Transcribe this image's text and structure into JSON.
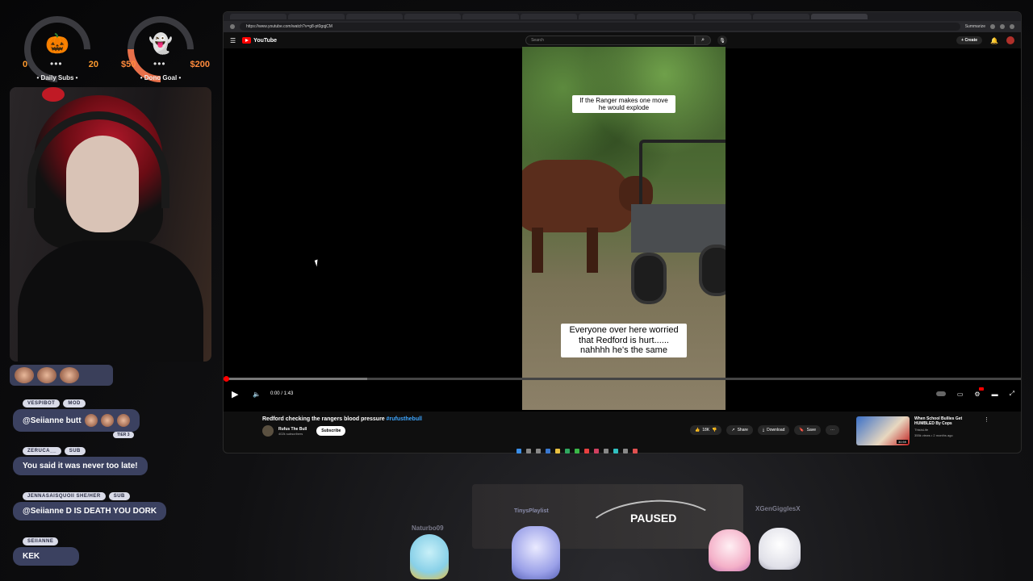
{
  "goals": {
    "subs": {
      "icon": "pumpkin-icon",
      "emoji": "🎃",
      "min": "0",
      "dots": "•••",
      "max": "20",
      "label": "• Daily Subs •"
    },
    "dono": {
      "icon": "ghost-icon",
      "emoji": "👻",
      "min": "$50",
      "dots": "•••",
      "max": "$200",
      "label": "• Dono Goal •"
    }
  },
  "chat": [
    {
      "tags": [
        "VESPIBOT",
        "MOD"
      ],
      "text": "@Seiianne butt",
      "tier": "TIER 3"
    },
    {
      "tags": [
        "ZERUCA__",
        "SUB"
      ],
      "text": "You said it was never too late!"
    },
    {
      "tags": [
        "JENNASAISQUOII SHE/HER",
        "SUB"
      ],
      "text": "@Seiianne D IS DEATH YOU DORK"
    },
    {
      "tags": [
        "SEIIANNE"
      ],
      "text": "KEK"
    }
  ],
  "browser": {
    "url": "https://www.youtube.com/watch?v=g8-pt0gqjCM",
    "summarize": "Summarize"
  },
  "youtube": {
    "logo": "YouTube",
    "search_placeholder": "Search",
    "create": "+ Create",
    "captions": {
      "top": "If the Ranger makes one move he would explode",
      "bottom": "Everyone over here worried that Redford is hurt...... nahhhh he's the same"
    },
    "time": "0:00 / 1:43",
    "progress_fraction": 0.003,
    "title": "Redford checking the rangers blood pressure",
    "hashtag": "#rufusthebull",
    "channel_name": "Rufus The Bull",
    "channel_subs": "402k subscribers",
    "subscribe": "Subscribe",
    "likes": "18K",
    "share": "Share",
    "download": "Download",
    "save": "Save",
    "recommended": {
      "title": "When School Bullies Get HUMBLED By Cops",
      "channel": "ThisIsLife",
      "meta": "355k views • 2 months ago",
      "duration": "30:59"
    }
  },
  "now_playing": {
    "playlist": "TinysPlaylist",
    "status": "PAUSED"
  },
  "viewers": {
    "left": "Naturbo09",
    "right": "XGenGigglesX"
  },
  "colors": {
    "accent_red": "#ff0000",
    "chat_bubble": "#3b4160",
    "goal_orange": "#ff9a2e",
    "link_blue": "#3ea6ff"
  }
}
